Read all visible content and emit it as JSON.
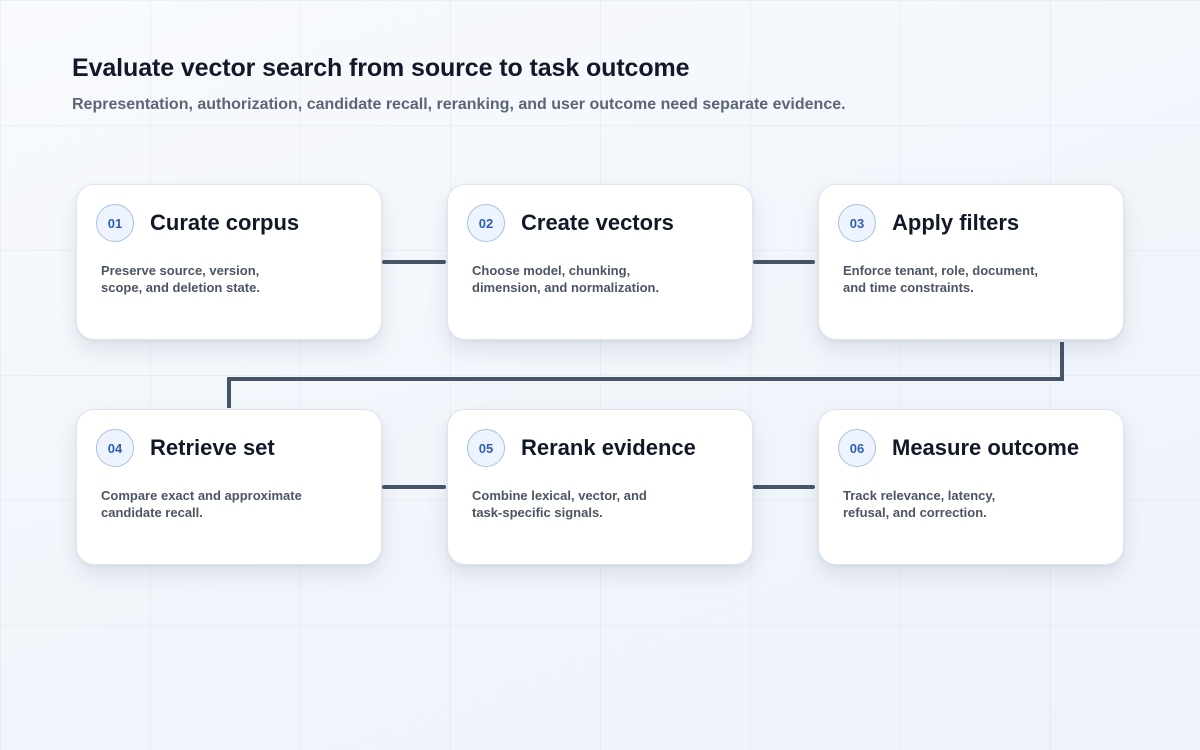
{
  "header": {
    "title": "Evaluate vector search from source to task outcome",
    "subtitle": "Representation, authorization, candidate recall, reranking, and user outcome need separate evidence."
  },
  "colors": {
    "connector": "#475569",
    "badge_text": "#2f5fae",
    "badge_border": "#a9c1e6"
  },
  "steps": [
    {
      "number": "01",
      "title": "Curate corpus",
      "description": [
        "Preserve source, version,",
        "scope, and deletion state."
      ]
    },
    {
      "number": "02",
      "title": "Create vectors",
      "description": [
        "Choose model, chunking,",
        "dimension, and normalization."
      ]
    },
    {
      "number": "03",
      "title": "Apply filters",
      "description": [
        "Enforce tenant, role, document,",
        "and time constraints."
      ]
    },
    {
      "number": "04",
      "title": "Retrieve set",
      "description": [
        "Compare exact and approximate",
        "candidate recall."
      ]
    },
    {
      "number": "05",
      "title": "Rerank evidence",
      "description": [
        "Combine lexical, vector, and",
        "task-specific signals."
      ]
    },
    {
      "number": "06",
      "title": "Measure outcome",
      "description": [
        "Track relevance, latency,",
        "refusal, and correction."
      ]
    }
  ]
}
